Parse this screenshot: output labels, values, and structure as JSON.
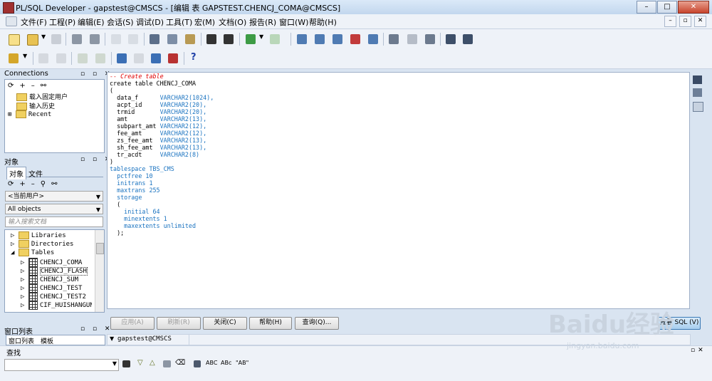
{
  "window": {
    "title": "PL/SQL Developer - gapstest@CMSCS - [编辑 表 GAPSTEST.CHENCJ_COMA@CMSCS]"
  },
  "menu": [
    "文件(F)",
    "工程(P)",
    "编辑(E)",
    "会话(S)",
    "调试(D)",
    "工具(T)",
    "宏(M)",
    "文档(O)",
    "报告(R)",
    "窗口(W)",
    "帮助(H)"
  ],
  "connections": {
    "title": "Connections",
    "items": [
      "载入固定用户",
      "输入历史",
      "Recent"
    ]
  },
  "objects": {
    "title": "对象",
    "tabs": [
      "对象",
      "文件"
    ],
    "user_select": "<当前用户>",
    "filter_select": "All objects",
    "search_placeholder": "输入搜索文档",
    "tree": {
      "folders": [
        "Libraries",
        "Directories",
        "Tables"
      ],
      "tables": [
        "CHENCJ_COMA",
        "CHENCJ_FLASH",
        "CHENCJ_SUM",
        "CHENCJ_TEST",
        "CHENCJ_TEST2",
        "CIF_HUISHANGUNING"
      ]
    }
  },
  "window_list": {
    "title": "窗口列表",
    "tabs": [
      "窗口列表",
      "模板"
    ]
  },
  "editor": {
    "comment": "-- Create table",
    "create_line": "create table CHENCJ_COMA",
    "open_paren": "(",
    "columns": [
      {
        "name": "data_f",
        "type": "VARCHAR2(1024),"
      },
      {
        "name": "acpt_id",
        "type": "VARCHAR2(20),"
      },
      {
        "name": "trmid",
        "type": "VARCHAR2(20),"
      },
      {
        "name": "amt",
        "type": "VARCHAR2(13),"
      },
      {
        "name": "subpart_amt",
        "type": "VARCHAR2(12),"
      },
      {
        "name": "fee_amt",
        "type": "VARCHAR2(12),"
      },
      {
        "name": "zs_fee_amt",
        "type": "VARCHAR2(13),"
      },
      {
        "name": "sh_fee_amt",
        "type": "VARCHAR2(13),"
      },
      {
        "name": "tr_acdt",
        "type": "VARCHAR2(8)"
      }
    ],
    "close_paren": ")",
    "tablespace": "tablespace TBS_CMS",
    "pctfree": "pctfree 10",
    "initrans": "initrans 1",
    "maxtrans": "maxtrans 255",
    "storage": "storage",
    "storage_open": "(",
    "initial": "initial 64",
    "minextents": "minextents 1",
    "maxextents": "maxextents unlimited",
    "storage_close": ");"
  },
  "buttons": {
    "apply": "应用(A)",
    "refresh": "刷新(R)",
    "close": "关闭(C)",
    "help": "帮助(H)",
    "query": "查询(Q)...",
    "view_sql": "查看 SQL (V)"
  },
  "status": {
    "connection": "gapstest@CMSCS"
  },
  "find": {
    "title": "查找"
  },
  "watermark": {
    "logo": "Baidu经验",
    "url": "jingyan.baidu.com"
  }
}
